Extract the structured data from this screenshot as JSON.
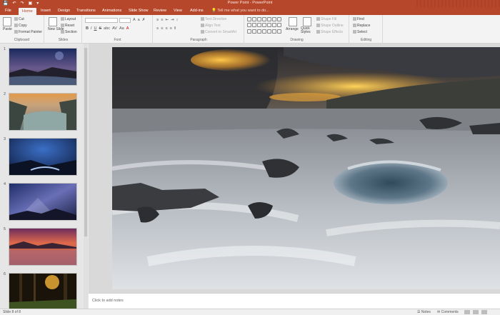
{
  "app": {
    "window_title": "Power Point - PowerPoint"
  },
  "tabs": [
    {
      "label": "File"
    },
    {
      "label": "Home"
    },
    {
      "label": "Insert"
    },
    {
      "label": "Design"
    },
    {
      "label": "Transitions"
    },
    {
      "label": "Animations"
    },
    {
      "label": "Slide Show"
    },
    {
      "label": "Review"
    },
    {
      "label": "View"
    },
    {
      "label": "Add-ins"
    }
  ],
  "tell_me": "Tell me what you want to do...",
  "ribbon": {
    "clipboard": {
      "label": "Clipboard",
      "paste": "Paste",
      "cut": "Cut",
      "copy": "Copy",
      "format_painter": "Format Painter"
    },
    "slides": {
      "label": "Slides",
      "new_slide": "New Slide",
      "layout": "Layout",
      "reset": "Reset",
      "section": "Section"
    },
    "font": {
      "label": "Font"
    },
    "paragraph": {
      "label": "Paragraph",
      "text_direction": "Text Direction",
      "align_text": "Align Text",
      "convert_smartart": "Convert to SmartArt"
    },
    "drawing": {
      "label": "Drawing",
      "arrange": "Arrange",
      "quick_styles": "Quick Styles",
      "shape_fill": "Shape Fill",
      "shape_outline": "Shape Outline",
      "shape_effects": "Shape Effects"
    },
    "editing": {
      "label": "Editing",
      "find": "Find",
      "replace": "Replace",
      "select": "Select"
    }
  },
  "thumbnails": [
    {
      "number": "1",
      "selected": false
    },
    {
      "number": "2",
      "selected": false
    },
    {
      "number": "3",
      "selected": false
    },
    {
      "number": "4",
      "selected": false
    },
    {
      "number": "5",
      "selected": false
    },
    {
      "number": "6",
      "selected": false
    }
  ],
  "notes_placeholder": "Click to add notes",
  "status": {
    "slide_counter": "Slide 8 of 8",
    "notes": "Notes",
    "comments": "Comments"
  },
  "colors": {
    "accent": "#b7472a",
    "ribbon_bg": "#f3f3f3"
  }
}
